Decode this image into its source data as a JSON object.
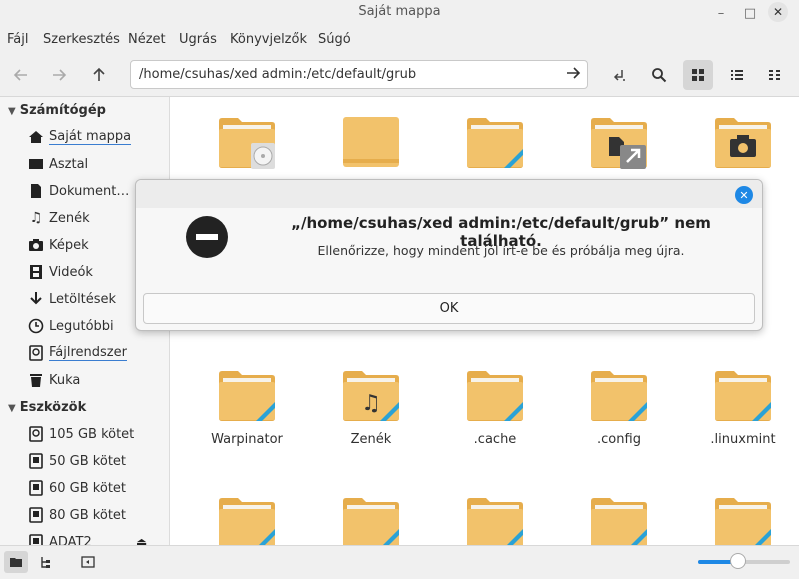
{
  "window": {
    "title": "Saját mappa",
    "minimize": "–",
    "maximize": "□",
    "close": "✕"
  },
  "menu": [
    "Fájl",
    "Szerkesztés",
    "Nézet",
    "Ugrás",
    "Könyvjelzők",
    "Súgó"
  ],
  "toolbar": {
    "path": "/home/csuhas/xed admin:/etc/default/grub"
  },
  "sidebar": {
    "computer_header": "Számítógép",
    "places": [
      {
        "label": "Saját mappa",
        "icon": "home-icon"
      },
      {
        "label": "Asztal",
        "icon": "desktop-icon"
      },
      {
        "label": "Dokument…",
        "icon": "document-icon"
      },
      {
        "label": "Zenék",
        "icon": "music-icon"
      },
      {
        "label": "Képek",
        "icon": "camera-icon"
      },
      {
        "label": "Videók",
        "icon": "film-icon"
      },
      {
        "label": "Letöltések",
        "icon": "download-icon"
      },
      {
        "label": "Legutóbbi",
        "icon": "clock-icon"
      },
      {
        "label": "Fájlrendszer",
        "icon": "drive-icon"
      },
      {
        "label": "Kuka",
        "icon": "trash-icon"
      }
    ],
    "devices_header": "Eszközök",
    "devices": [
      {
        "label": "105 GB kötet"
      },
      {
        "label": "50 GB kötet"
      },
      {
        "label": "60 GB kötet"
      },
      {
        "label": "80 GB kötet"
      },
      {
        "label": "ADAT2"
      }
    ]
  },
  "files": {
    "row1": [
      {
        "label": "",
        "emblem": "disc"
      },
      {
        "label": "",
        "emblem": "plain"
      },
      {
        "label": "",
        "emblem": "link"
      },
      {
        "label": "",
        "emblem": "doc-link"
      },
      {
        "label": "",
        "emblem": "camera"
      }
    ],
    "row2": [
      {
        "label": "Warpinator",
        "emblem": "link"
      },
      {
        "label": "Zenék",
        "emblem": "music"
      },
      {
        "label": ".cache",
        "emblem": "link"
      },
      {
        "label": ".config",
        "emblem": "link"
      },
      {
        "label": ".linuxmint",
        "emblem": "link"
      }
    ],
    "row3": [
      {
        "label": "",
        "emblem": "link"
      },
      {
        "label": "",
        "emblem": "link"
      },
      {
        "label": "",
        "emblem": "link"
      },
      {
        "label": "",
        "emblem": "link"
      },
      {
        "label": "",
        "emblem": "link"
      }
    ]
  },
  "dialog": {
    "title": "„/home/csuhas/xed admin:/etc/default/grub” nem található.",
    "message": "Ellenőrizze, hogy mindent jól írt-e be és próbálja meg újra.",
    "ok_label": "OK",
    "close": "✕"
  },
  "statusbar": {
    "zoom": 0.88
  },
  "colors": {
    "folder": "#f2c26b",
    "folder_tab": "#e6ad4c",
    "accent": "#1e88e5",
    "link_stripe": "#2aa2d6"
  }
}
